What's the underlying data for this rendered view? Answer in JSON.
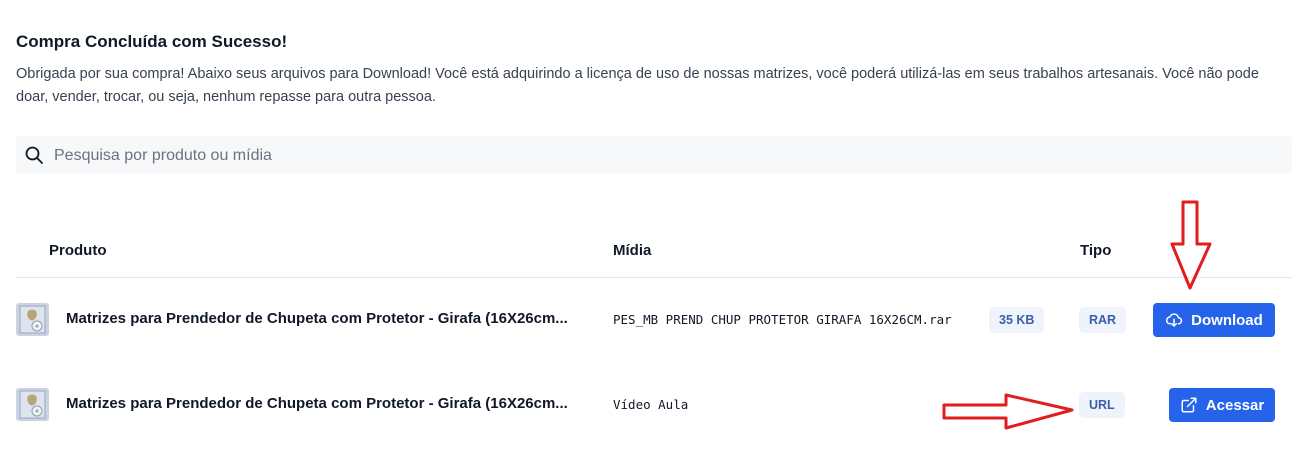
{
  "header": {
    "title": "Compra Concluída com Sucesso!",
    "description": "Obrigada por sua compra! Abaixo seus arquivos para Download! Você está adquirindo a licença de uso de nossas matrizes, você poderá utilizá-las em seus trabalhos artesanais. Você não pode doar, vender, trocar, ou seja, nenhum repasse para outra pessoa."
  },
  "search": {
    "placeholder": "Pesquisa por produto ou mídia",
    "icon": "search-icon"
  },
  "table": {
    "columns": {
      "produto": "Produto",
      "midia": "Mídia",
      "tipo": "Tipo"
    },
    "rows": [
      {
        "product": "Matrizes para Prendedor de Chupeta com Protetor - Girafa (16X26cm...",
        "media": "PES_MB PREND CHUP PROTETOR GIRAFA 16X26CM.rar",
        "size": "35 KB",
        "type": "RAR",
        "action": "Download",
        "action_icon": "cloud-download-icon"
      },
      {
        "product": "Matrizes para Prendedor de Chupeta com Protetor - Girafa (16X26cm...",
        "media": "Vídeo Aula",
        "size": "",
        "type": "URL",
        "action": "Acessar",
        "action_icon": "external-link-icon"
      }
    ]
  },
  "colors": {
    "primary": "#2563eb",
    "badge_bg": "#eef3fc",
    "badge_text": "#3b5fa8",
    "annotation": "#e11d1d"
  }
}
